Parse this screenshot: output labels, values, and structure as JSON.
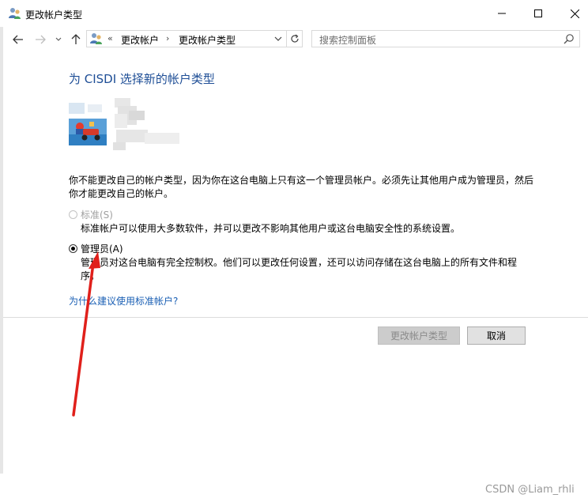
{
  "window": {
    "title": "更改帐户类型",
    "controls": {
      "minimize": "minimize",
      "maximize": "maximize",
      "close": "close"
    }
  },
  "nav": {
    "breadcrumb": [
      "更改帐户",
      "更改帐户类型"
    ],
    "search_placeholder": "搜索控制面板"
  },
  "main": {
    "heading": "为 CISDI 选择新的帐户类型",
    "description": "你不能更改自己的帐户类型，因为你在这台电脑上只有这一个管理员帐户。必须先让其他用户成为管理员，然后你才能更改自己的帐户。",
    "options": [
      {
        "label": "标准(S)",
        "description": "标准帐户可以使用大多数软件，并可以更改不影响其他用户或这台电脑安全性的系统设置。",
        "selected": false,
        "enabled": false
      },
      {
        "label": "管理员(A)",
        "description": "管理员对这台电脑有完全控制权。他们可以更改任何设置，还可以访问存储在这台电脑上的所有文件和程序。",
        "selected": true,
        "enabled": true
      }
    ],
    "help_link": "为什么建议使用标准帐户?"
  },
  "buttons": {
    "change": "更改帐户类型",
    "cancel": "取消"
  },
  "annotation": {
    "arrow_color": "#e0201b"
  },
  "watermark": "CSDN @Liam_rhli",
  "colors": {
    "heading": "#1e4e96",
    "link": "#1a5fb4"
  }
}
